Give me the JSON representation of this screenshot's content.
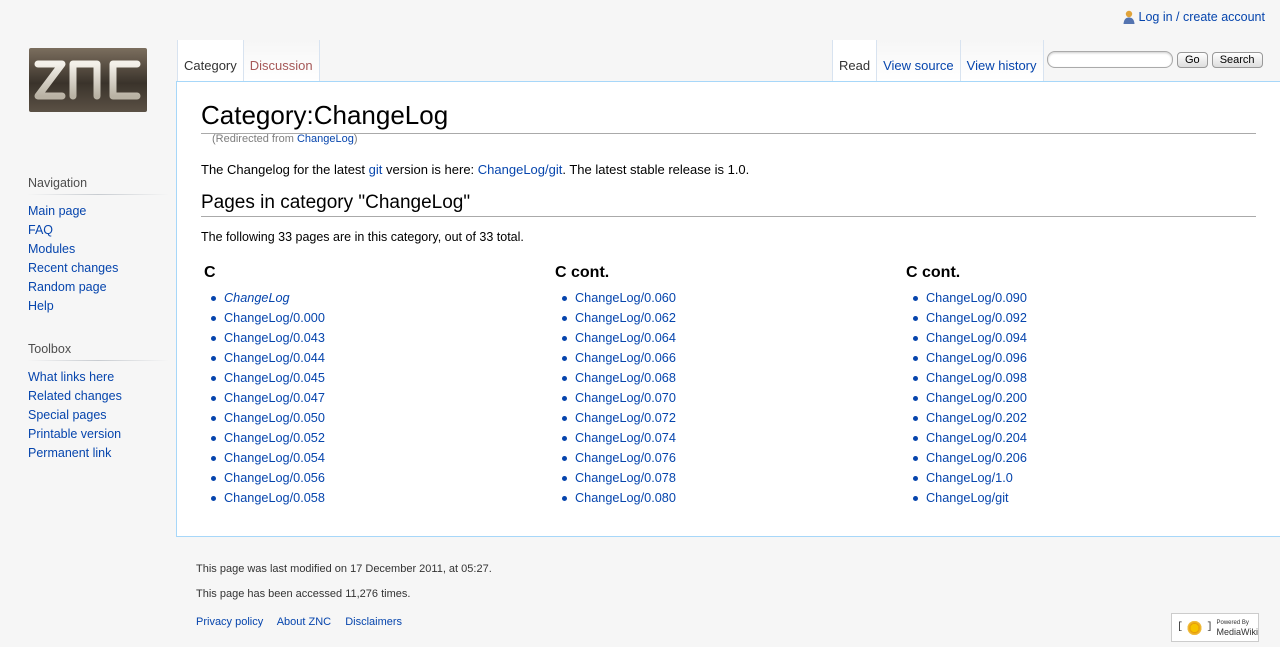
{
  "personal": {
    "login_label": "Log in / create account"
  },
  "tabs_left": [
    {
      "label": "Category"
    },
    {
      "label": "Discussion"
    }
  ],
  "tabs_right": [
    {
      "label": "Read"
    },
    {
      "label": "View source"
    },
    {
      "label": "View history"
    }
  ],
  "search": {
    "go_label": "Go",
    "search_label": "Search"
  },
  "page": {
    "title": "Category:ChangeLog",
    "redirect_prefix": "(Redirected from ",
    "redirect_link": "ChangeLog",
    "redirect_suffix": ")",
    "intro_1": "The Changelog for the latest ",
    "intro_link1": "git",
    "intro_2": " version is here: ",
    "intro_link2": "ChangeLog/git",
    "intro_3": ". The latest stable release is 1.0.",
    "section_heading": "Pages in category \"ChangeLog\"",
    "count_text": "The following 33 pages are in this category, out of 33 total.",
    "columns": [
      {
        "heading": "C",
        "items": [
          "ChangeLog",
          "ChangeLog/0.000",
          "ChangeLog/0.043",
          "ChangeLog/0.044",
          "ChangeLog/0.045",
          "ChangeLog/0.047",
          "ChangeLog/0.050",
          "ChangeLog/0.052",
          "ChangeLog/0.054",
          "ChangeLog/0.056",
          "ChangeLog/0.058"
        ]
      },
      {
        "heading": "C cont.",
        "items": [
          "ChangeLog/0.060",
          "ChangeLog/0.062",
          "ChangeLog/0.064",
          "ChangeLog/0.066",
          "ChangeLog/0.068",
          "ChangeLog/0.070",
          "ChangeLog/0.072",
          "ChangeLog/0.074",
          "ChangeLog/0.076",
          "ChangeLog/0.078",
          "ChangeLog/0.080"
        ]
      },
      {
        "heading": "C cont.",
        "items": [
          "ChangeLog/0.090",
          "ChangeLog/0.092",
          "ChangeLog/0.094",
          "ChangeLog/0.096",
          "ChangeLog/0.098",
          "ChangeLog/0.200",
          "ChangeLog/0.202",
          "ChangeLog/0.204",
          "ChangeLog/0.206",
          "ChangeLog/1.0",
          "ChangeLog/git"
        ]
      }
    ]
  },
  "sidebar": {
    "navigation": {
      "heading": "Navigation",
      "items": [
        "Main page",
        "FAQ",
        "Modules",
        "Recent changes",
        "Random page",
        "Help"
      ]
    },
    "toolbox": {
      "heading": "Toolbox",
      "items": [
        "What links here",
        "Related changes",
        "Special pages",
        "Printable version",
        "Permanent link"
      ]
    }
  },
  "footer": {
    "last_modified": "This page was last modified on 17 December 2011, at 05:27.",
    "accessed": "This page has been accessed 11,276 times.",
    "links": [
      "Privacy policy",
      "About ZNC",
      "Disclaimers"
    ],
    "powered_by": "Powered By",
    "powered_name": "MediaWiki"
  },
  "logo_text": "ZNC",
  "colors": {
    "link": "#0645ad",
    "new_link": "#a55858",
    "border": "#a7d7f9"
  }
}
